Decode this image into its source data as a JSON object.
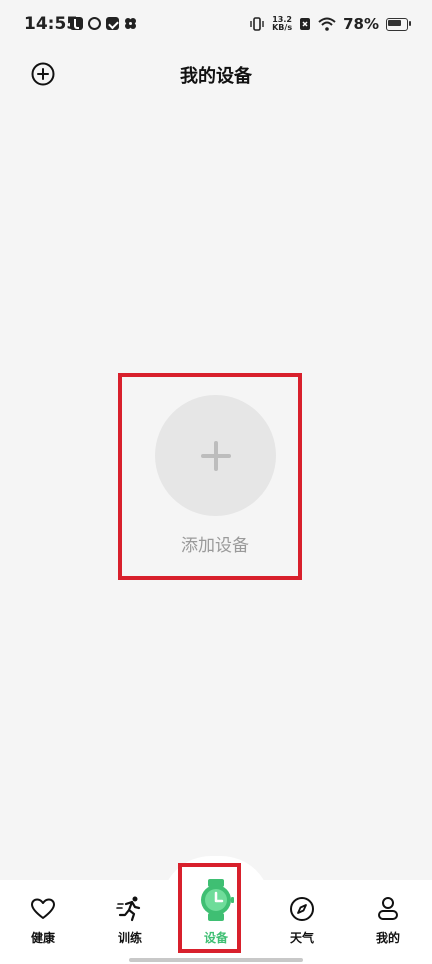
{
  "status_bar": {
    "time": "14:55",
    "net_speed_value": "13.2",
    "net_speed_unit": "KB/s",
    "battery_percent": "78%"
  },
  "header": {
    "title": "我的设备",
    "add_icon": "plus-circle-icon"
  },
  "main": {
    "add_device_label": "添加设备",
    "add_device_icon": "plus-icon"
  },
  "bottom_nav": {
    "items": [
      {
        "label": "健康",
        "icon": "heart-icon"
      },
      {
        "label": "训练",
        "icon": "running-icon"
      },
      {
        "label": "设备",
        "icon": "watch-icon",
        "active": true
      },
      {
        "label": "天气",
        "icon": "compass-icon"
      },
      {
        "label": "我的",
        "icon": "person-icon"
      }
    ]
  },
  "colors": {
    "background": "#f5f5f5",
    "accent_green": "#3fbf73",
    "highlight_red": "#d8202c",
    "add_circle": "#e6e6e6",
    "muted_text": "#9a9a9a"
  }
}
